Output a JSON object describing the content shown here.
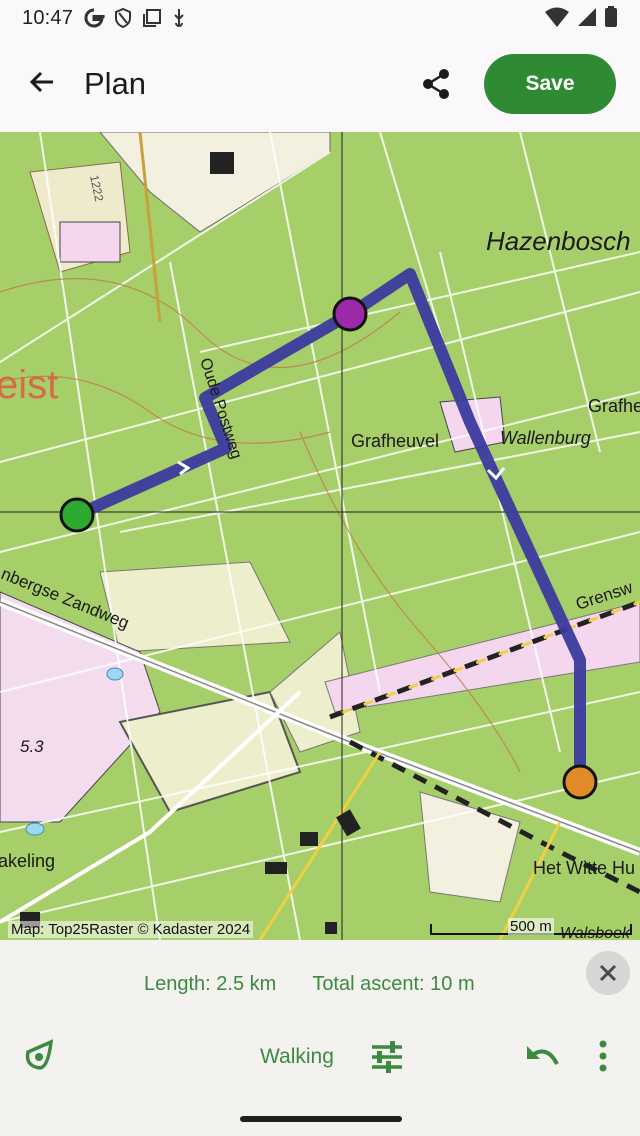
{
  "status": {
    "time": "10:47"
  },
  "app_bar": {
    "title": "Plan",
    "save_label": "Save"
  },
  "map": {
    "labels": {
      "hazenbosch": "Hazenbosch",
      "zeist": "eist",
      "grafheuvel": "Grafheuvel",
      "wallenburg": "Wallenburg",
      "grafhe": "Grafhe",
      "oude_postweg": "Oude Postweg",
      "zandweg": "nbergse Zandweg",
      "grensweg": "Grensw",
      "height": "5.3",
      "keling": "akeling",
      "witte_huis": "Het Witte Hu",
      "walsboek": "Walsboek",
      "road_num": "1222"
    },
    "attribution": "Map: Top25Raster © Kadaster 2024",
    "scale_label": "500 m",
    "colors": {
      "route": "#3a3a9e",
      "start": "#2eab2e",
      "via": "#9c2aa8",
      "end": "#e08a2a"
    }
  },
  "panel": {
    "length": "Length: 2.5 km",
    "ascent": "Total ascent: 10 m",
    "mode": "Walking",
    "accent": "#3c8a3f"
  },
  "icons": {
    "back": "arrow-left-icon",
    "share": "share-icon",
    "close": "close-icon",
    "mode": "walking-route-icon",
    "tune": "tune-icon",
    "undo": "undo-icon",
    "more": "more-vert-icon"
  }
}
